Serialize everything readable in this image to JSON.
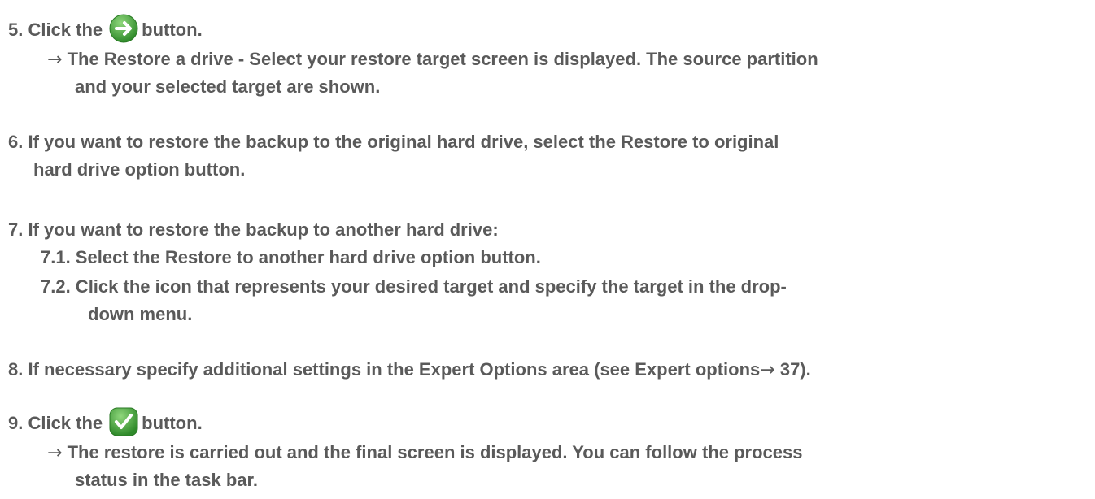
{
  "step5": {
    "prefix": "5. Click the",
    "icon": "forward-arrow-icon",
    "suffix": "button.",
    "result_arrow": "→",
    "result_line1": "The Restore a drive - Select your restore target screen is displayed. The source partition",
    "result_line2": "and your selected target are shown."
  },
  "step6": {
    "line1": "6. If you want to restore the backup to the original hard drive, select the Restore to original",
    "line2": "hard drive option button."
  },
  "step7": {
    "line1": "7. If you want to restore the backup to another hard drive:",
    "sub1": "7.1. Select the Restore to another hard drive option button.",
    "sub2_line1": "7.2. Click the icon that represents your desired target and specify the target in the drop-",
    "sub2_line2": "down menu."
  },
  "step8": {
    "text": "8. If necessary specify additional settings in the Expert Options area (see Expert options",
    "arrow": "→",
    "page_ref": "37)."
  },
  "step9": {
    "prefix": "9. Click the",
    "icon": "checkmark-icon",
    "suffix": "button.",
    "result_arrow": "→",
    "result_line1": "The restore is carried out and the final screen is displayed. You can follow the process",
    "result_line2": "status in the task bar."
  },
  "colors": {
    "text": "#5a5a5a",
    "icon_green": "#3f9a35",
    "icon_green_light": "#7cc86a"
  }
}
